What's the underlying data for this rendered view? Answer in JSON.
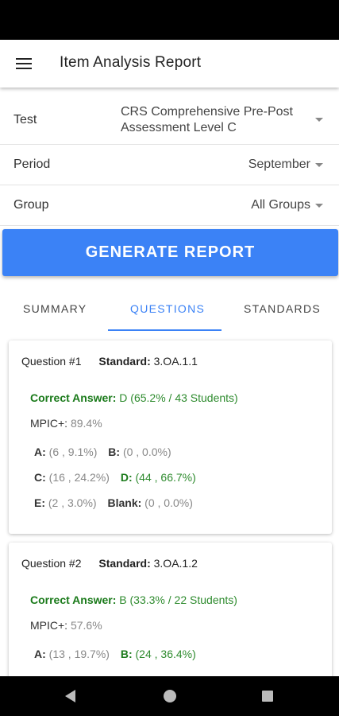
{
  "app_bar": {
    "title": "Item Analysis Report",
    "menu_icon": "hamburger-menu-icon"
  },
  "filters": {
    "test": {
      "label": "Test",
      "value_line1": "CRS Comprehensive Pre-Post",
      "value_line2": "Assessment Level C"
    },
    "period": {
      "label": "Period",
      "value": "September"
    },
    "group": {
      "label": "Group",
      "value": "All Groups"
    }
  },
  "generate_button": {
    "label": "GENERATE REPORT"
  },
  "tabs": [
    {
      "label": "SUMMARY",
      "active": false
    },
    {
      "label": "QUESTIONS",
      "active": true
    },
    {
      "label": "STANDARDS",
      "active": false
    }
  ],
  "questions": [
    {
      "title": "Question #1",
      "standard_label": "Standard:",
      "standard_value": "3.OA.1.1",
      "correct_label": "Correct Answer:",
      "correct_value": "D (65.2% / 43 Students)",
      "mpic_label": "MPIC+:",
      "mpic_value": "89.4%",
      "options": {
        "a_label": "A:",
        "a_value": "(6 , 9.1%)",
        "b_label": "B:",
        "b_value": "(0 , 0.0%)",
        "c_label": "C:",
        "c_value": "(16 , 24.2%)",
        "d_label": "D:",
        "d_value": "(44 , 66.7%)",
        "e_label": "E:",
        "e_value": "(2 , 3.0%)",
        "blank_label": "Blank:",
        "blank_value": "(0 , 0.0%)"
      }
    },
    {
      "title": "Question #2",
      "standard_label": "Standard:",
      "standard_value": "3.OA.1.2",
      "correct_label": "Correct Answer:",
      "correct_value": "B (33.3% / 22 Students)",
      "mpic_label": "MPIC+:",
      "mpic_value": "57.6%",
      "options": {
        "a_label": "A:",
        "a_value": "(13 , 19.7%)",
        "b_label": "B:",
        "b_value": "(24 , 36.4%)"
      }
    }
  ],
  "colors": {
    "accent": "#3b82f6",
    "correct": "#2e8b2e"
  },
  "nav": {
    "back_icon": "back-triangle-icon",
    "home_icon": "home-circle-icon",
    "recent_icon": "recent-apps-square-icon"
  }
}
